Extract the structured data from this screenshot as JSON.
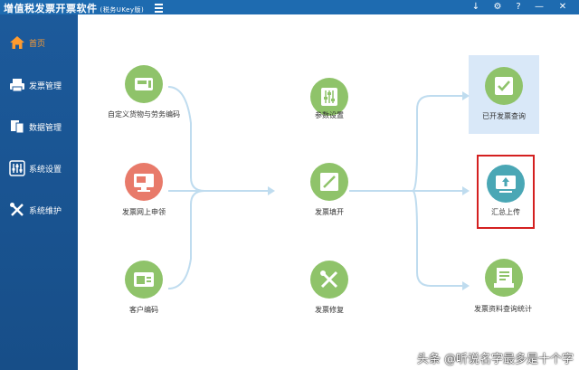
{
  "app": {
    "title": "增值税发票开票软件",
    "subtitle": "(税务UKey版)"
  },
  "window_controls": [
    "↓",
    "⚙",
    "?",
    "—",
    "✕"
  ],
  "sidebar": {
    "items": [
      {
        "label": "首页",
        "icon": "home-icon",
        "active": true
      },
      {
        "label": "发票管理",
        "icon": "printer-icon"
      },
      {
        "label": "数据管理",
        "icon": "data-icon"
      },
      {
        "label": "系统设置",
        "icon": "sliders-icon"
      },
      {
        "label": "系统维护",
        "icon": "tools-icon"
      }
    ]
  },
  "nodes": {
    "goods_code": {
      "label": "自定义货物与劳务编码",
      "icon": "goods-card-icon"
    },
    "invoice_apply": {
      "label": "发票网上申领",
      "icon": "monitor-invoice-icon"
    },
    "customer_code": {
      "label": "客户编码",
      "icon": "wallet-card-icon"
    },
    "params": {
      "label": "参数设置",
      "icon": "sliders-icon"
    },
    "invoice_fill": {
      "label": "发票填开",
      "icon": "pen-paper-icon"
    },
    "invoice_repair": {
      "label": "发票修复",
      "icon": "tools-icon"
    },
    "issued_query": {
      "label": "已开发票查询",
      "icon": "checked-doc-icon"
    },
    "summary_upload": {
      "label": "汇总上传",
      "icon": "upload-monitor-icon"
    },
    "data_stats": {
      "label": "发票资料查询统计",
      "icon": "doc-stack-icon"
    }
  },
  "colors": {
    "topbar": "#1e6bb0",
    "sidebar": "#1c5a9b",
    "active": "#ff9b2f",
    "circle_green": "#8fc36a",
    "circle_red": "#e87a6a",
    "circle_teal": "#4aa7b5",
    "connector": "#bfdcef",
    "highlight_box": "#d9e8f8",
    "red_frame": "#d42020"
  },
  "watermark": "头条 @听说名字最多是十个字"
}
